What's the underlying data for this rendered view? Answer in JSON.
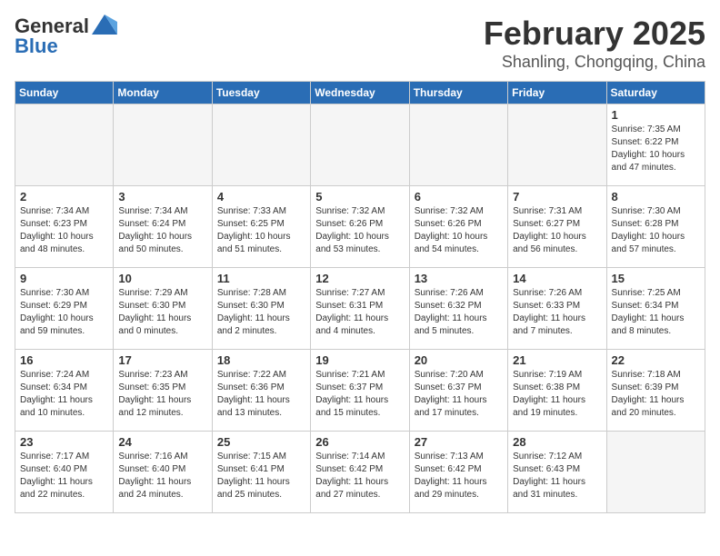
{
  "header": {
    "logo_general": "General",
    "logo_blue": "Blue",
    "month_title": "February 2025",
    "location": "Shanling, Chongqing, China"
  },
  "weekdays": [
    "Sunday",
    "Monday",
    "Tuesday",
    "Wednesday",
    "Thursday",
    "Friday",
    "Saturday"
  ],
  "weeks": [
    [
      {
        "day": "",
        "info": ""
      },
      {
        "day": "",
        "info": ""
      },
      {
        "day": "",
        "info": ""
      },
      {
        "day": "",
        "info": ""
      },
      {
        "day": "",
        "info": ""
      },
      {
        "day": "",
        "info": ""
      },
      {
        "day": "1",
        "info": "Sunrise: 7:35 AM\nSunset: 6:22 PM\nDaylight: 10 hours and 47 minutes."
      }
    ],
    [
      {
        "day": "2",
        "info": "Sunrise: 7:34 AM\nSunset: 6:23 PM\nDaylight: 10 hours and 48 minutes."
      },
      {
        "day": "3",
        "info": "Sunrise: 7:34 AM\nSunset: 6:24 PM\nDaylight: 10 hours and 50 minutes."
      },
      {
        "day": "4",
        "info": "Sunrise: 7:33 AM\nSunset: 6:25 PM\nDaylight: 10 hours and 51 minutes."
      },
      {
        "day": "5",
        "info": "Sunrise: 7:32 AM\nSunset: 6:26 PM\nDaylight: 10 hours and 53 minutes."
      },
      {
        "day": "6",
        "info": "Sunrise: 7:32 AM\nSunset: 6:26 PM\nDaylight: 10 hours and 54 minutes."
      },
      {
        "day": "7",
        "info": "Sunrise: 7:31 AM\nSunset: 6:27 PM\nDaylight: 10 hours and 56 minutes."
      },
      {
        "day": "8",
        "info": "Sunrise: 7:30 AM\nSunset: 6:28 PM\nDaylight: 10 hours and 57 minutes."
      }
    ],
    [
      {
        "day": "9",
        "info": "Sunrise: 7:30 AM\nSunset: 6:29 PM\nDaylight: 10 hours and 59 minutes."
      },
      {
        "day": "10",
        "info": "Sunrise: 7:29 AM\nSunset: 6:30 PM\nDaylight: 11 hours and 0 minutes."
      },
      {
        "day": "11",
        "info": "Sunrise: 7:28 AM\nSunset: 6:30 PM\nDaylight: 11 hours and 2 minutes."
      },
      {
        "day": "12",
        "info": "Sunrise: 7:27 AM\nSunset: 6:31 PM\nDaylight: 11 hours and 4 minutes."
      },
      {
        "day": "13",
        "info": "Sunrise: 7:26 AM\nSunset: 6:32 PM\nDaylight: 11 hours and 5 minutes."
      },
      {
        "day": "14",
        "info": "Sunrise: 7:26 AM\nSunset: 6:33 PM\nDaylight: 11 hours and 7 minutes."
      },
      {
        "day": "15",
        "info": "Sunrise: 7:25 AM\nSunset: 6:34 PM\nDaylight: 11 hours and 8 minutes."
      }
    ],
    [
      {
        "day": "16",
        "info": "Sunrise: 7:24 AM\nSunset: 6:34 PM\nDaylight: 11 hours and 10 minutes."
      },
      {
        "day": "17",
        "info": "Sunrise: 7:23 AM\nSunset: 6:35 PM\nDaylight: 11 hours and 12 minutes."
      },
      {
        "day": "18",
        "info": "Sunrise: 7:22 AM\nSunset: 6:36 PM\nDaylight: 11 hours and 13 minutes."
      },
      {
        "day": "19",
        "info": "Sunrise: 7:21 AM\nSunset: 6:37 PM\nDaylight: 11 hours and 15 minutes."
      },
      {
        "day": "20",
        "info": "Sunrise: 7:20 AM\nSunset: 6:37 PM\nDaylight: 11 hours and 17 minutes."
      },
      {
        "day": "21",
        "info": "Sunrise: 7:19 AM\nSunset: 6:38 PM\nDaylight: 11 hours and 19 minutes."
      },
      {
        "day": "22",
        "info": "Sunrise: 7:18 AM\nSunset: 6:39 PM\nDaylight: 11 hours and 20 minutes."
      }
    ],
    [
      {
        "day": "23",
        "info": "Sunrise: 7:17 AM\nSunset: 6:40 PM\nDaylight: 11 hours and 22 minutes."
      },
      {
        "day": "24",
        "info": "Sunrise: 7:16 AM\nSunset: 6:40 PM\nDaylight: 11 hours and 24 minutes."
      },
      {
        "day": "25",
        "info": "Sunrise: 7:15 AM\nSunset: 6:41 PM\nDaylight: 11 hours and 25 minutes."
      },
      {
        "day": "26",
        "info": "Sunrise: 7:14 AM\nSunset: 6:42 PM\nDaylight: 11 hours and 27 minutes."
      },
      {
        "day": "27",
        "info": "Sunrise: 7:13 AM\nSunset: 6:42 PM\nDaylight: 11 hours and 29 minutes."
      },
      {
        "day": "28",
        "info": "Sunrise: 7:12 AM\nSunset: 6:43 PM\nDaylight: 11 hours and 31 minutes."
      },
      {
        "day": "",
        "info": ""
      }
    ]
  ]
}
